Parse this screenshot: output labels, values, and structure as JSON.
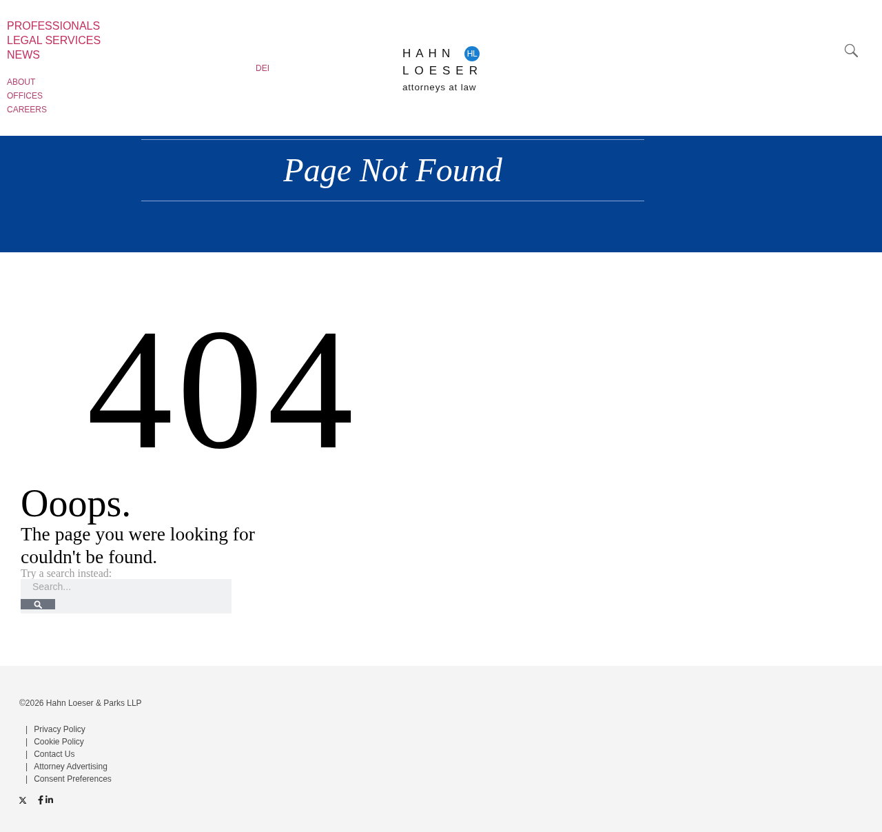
{
  "header": {
    "primary_nav": [
      "PROFESSIONALS",
      "LEGAL SERVICES",
      "NEWS"
    ],
    "secondary_nav": [
      "ABOUT",
      "OFFICES",
      "CAREERS"
    ],
    "extra_nav": [
      "DEI"
    ],
    "logo": {
      "line_1": "HAHN",
      "monogram": "HL",
      "line_2": "LOESER",
      "tagline": "attorneys at law"
    }
  },
  "banner": {
    "title": "Page Not Found"
  },
  "error": {
    "code": "404",
    "heading": "Ooops.",
    "message": "The page you were looking for couldn't be found.",
    "search_hint": "Try a search instead:",
    "search": {
      "placeholder": "Search..."
    }
  },
  "footer": {
    "copyright": "©2026 Hahn Loeser & Parks LLP",
    "links": [
      {
        "separator": "|",
        "label": "Privacy Policy"
      },
      {
        "separator": "|",
        "label": "Cookie Policy"
      },
      {
        "separator": "|",
        "label": "Contact Us"
      },
      {
        "separator": "|",
        "label": "Attorney Advertising"
      },
      {
        "separator": "|",
        "label": "Consent Preferences"
      }
    ],
    "social": [
      {
        "kind": "x"
      },
      {
        "kind": "facebook"
      },
      {
        "kind": "linkedin"
      }
    ]
  }
}
